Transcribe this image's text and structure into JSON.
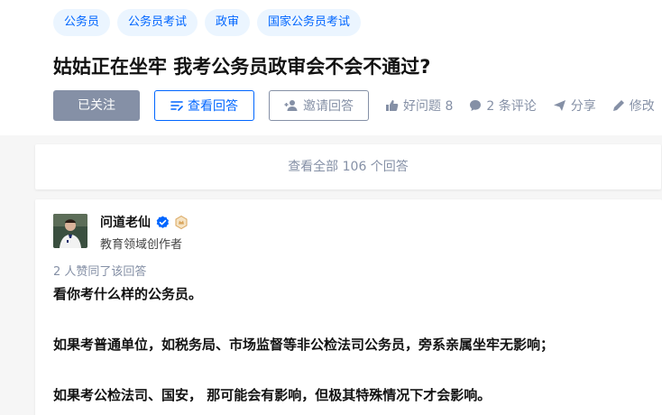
{
  "question": {
    "topics": [
      "公务员",
      "公务员考试",
      "政审",
      "国家公务员考试"
    ],
    "title": "姑姑正在坐牢 我考公务员政审会不会不通过?",
    "actions": {
      "follow_label": "已关注",
      "view_answers_label": "查看回答",
      "invite_label": "邀请回答",
      "good_question_label": "好问题 8",
      "comments_label": "2 条评论",
      "share_label": "分享",
      "edit_label": "修改"
    }
  },
  "view_all": {
    "label": "查看全部 106 个回答"
  },
  "answer": {
    "author": {
      "name": "问道老仙",
      "description": "教育领域创作者"
    },
    "upvote_info": "2 人赞同了该回答",
    "paragraphs": [
      "看你考什么样的公务员。",
      "如果考普通单位，如税务局、市场监督等非公检法司公务员，旁系亲属坐牢无影响；",
      "如果考公检法司、国安， 那可能会有影响，但极其特殊情况下才会影响。"
    ]
  },
  "colors": {
    "brand_blue": "#0066ff",
    "muted_gray": "#8590a6",
    "tag_background": "#ebf5ff",
    "page_background": "#f6f6f6"
  },
  "icons": [
    "edit-list-icon",
    "invite-person-icon",
    "thumbs-up-icon",
    "comment-bubble-icon",
    "share-plane-icon",
    "pencil-icon",
    "verified-badge-icon",
    "creator-level-badge-icon"
  ]
}
